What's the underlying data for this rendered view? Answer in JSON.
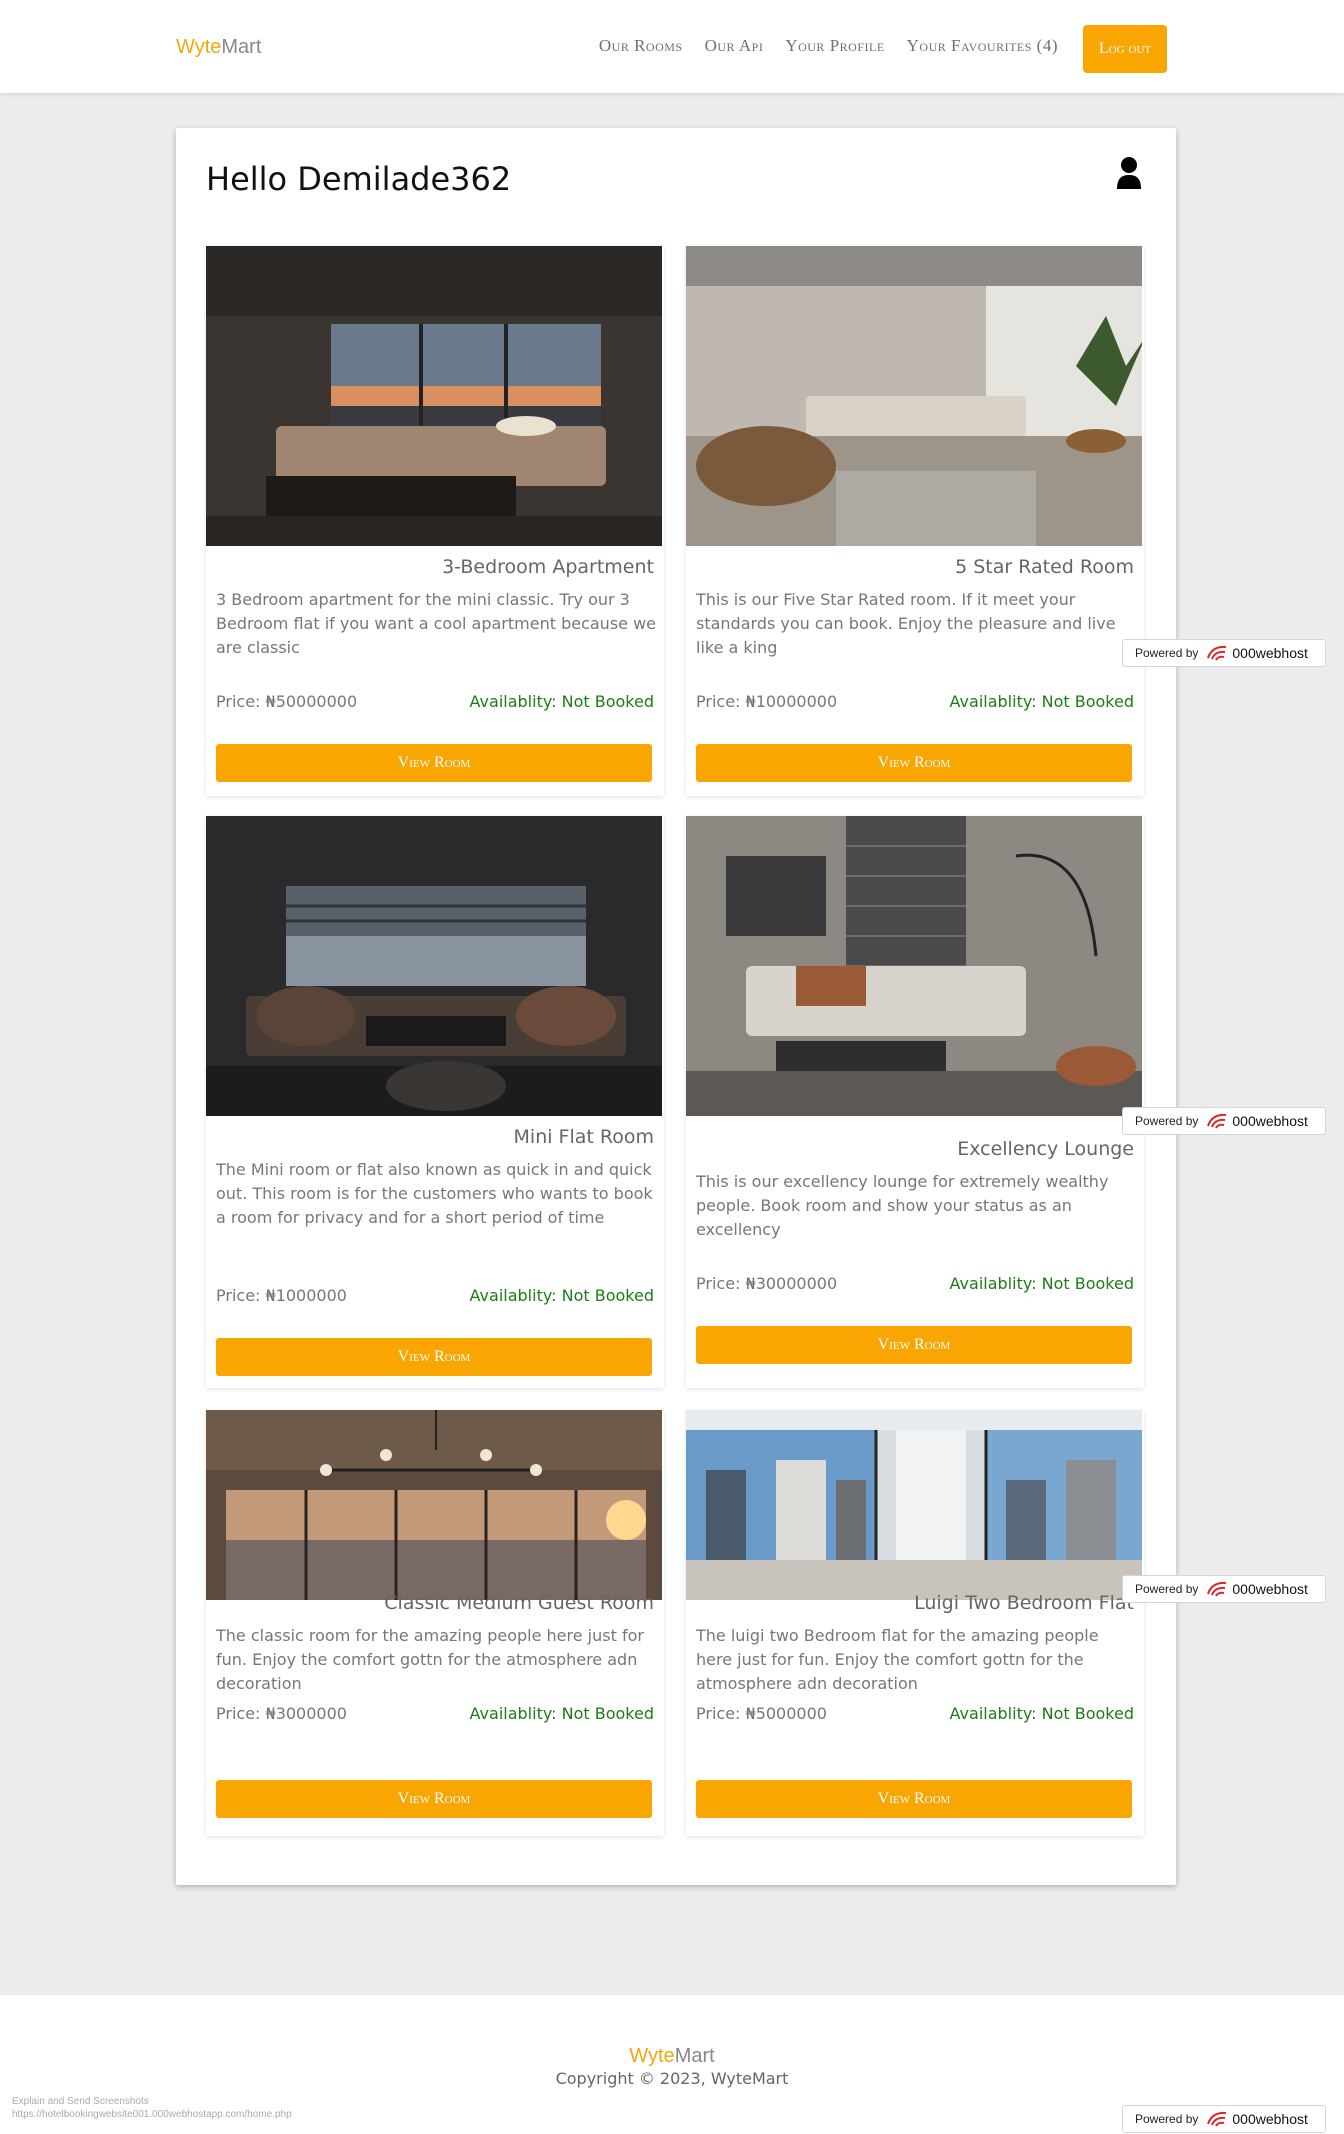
{
  "nav": {
    "brand_part1": "Wyte",
    "brand_part2": "Mart",
    "links": [
      "Our Rooms",
      "Our Api",
      "Your Profile",
      "Your Favourites (4)"
    ],
    "logout": "Log out"
  },
  "greeting": "Hello Demilade362",
  "rooms": [
    {
      "title": "3-Bedroom Apartment",
      "description": "3 Bedroom apartment for the mini classic. Try our 3 Bedroom flat if you want a cool apartment because we are classic",
      "price": "Price: ₦50000000",
      "availability": "Availablity: Not Booked",
      "button": "View Room"
    },
    {
      "title": "5 Star Rated Room",
      "description": "This is our Five Star Rated room. If it meet your standards you can book. Enjoy the pleasure and live like a king",
      "price": "Price: ₦10000000",
      "availability": "Availablity: Not Booked",
      "button": "View Room"
    },
    {
      "title": "Mini Flat Room",
      "description": "The Mini room or flat also known as quick in and quick out. This room is for the customers who wants to book a room for privacy and for a short period of time",
      "price": "Price: ₦1000000",
      "availability": "Availablity: Not Booked",
      "button": "View Room"
    },
    {
      "title": "Excellency Lounge",
      "description": "This is our excellency lounge for extremely wealthy people. Book room and show your status as an excellency",
      "price": "Price: ₦30000000",
      "availability": "Availablity: Not Booked",
      "button": "View Room"
    },
    {
      "title": "Classic Medium Guest Room",
      "description": "The classic room for the amazing people here just for fun. Enjoy the comfort gottn for the atmosphere adn decoration",
      "price": "Price: ₦3000000",
      "availability": "Availablity: Not Booked",
      "button": "View Room"
    },
    {
      "title": "Luigi Two Bedroom Flat",
      "description": "The luigi two Bedroom flat for the amazing people here just for fun. Enjoy the comfort gottn for the atmosphere adn decoration",
      "price": "Price: ₦5000000",
      "availability": "Availablity: Not Booked",
      "button": "View Room"
    }
  ],
  "powered": {
    "label": "Powered by",
    "host": "000webhost"
  },
  "footer": {
    "brand_part1": "Wyte",
    "brand_part2": "Mart",
    "copyright": "Copyright © 2023, WyteMart",
    "tool_note": "Explain and Send Screenshots",
    "url": "https://hotelbookingwebsite001.000webhostapp.com/home.php"
  },
  "colors": {
    "accent": "#f9a603",
    "available": "#1c7c15"
  }
}
